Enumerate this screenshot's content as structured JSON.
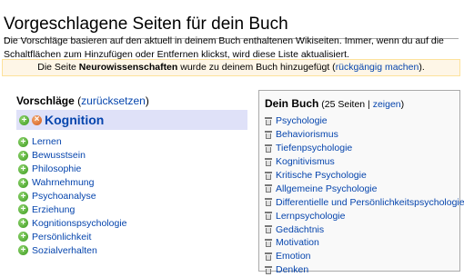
{
  "page": {
    "title": "Vorgeschlagene Seiten für dein Buch",
    "intro": "Die Vorschläge basieren auf den aktuell in deinem Buch enthaltenen Wikiseiten. Immer, wenn du auf die Schaltflächen zum Hinzufügen oder Entfernen klickst, wird diese Liste aktualisiert."
  },
  "notice": {
    "prefix": "Die Seite ",
    "page_name": "Neurowissenschaften",
    "middle": " wurde zu deinem Buch hinzugefügt (",
    "undo_link": "rückgängig machen",
    "suffix": ")."
  },
  "suggestions": {
    "heading": "Vorschläge",
    "reset_open": " (",
    "reset_link": "zurücksetzen",
    "reset_close": ")",
    "highlighted": "Kognition",
    "items": [
      "Lernen",
      "Bewusstsein",
      "Philosophie",
      "Wahrnehmung",
      "Psychoanalyse",
      "Erziehung",
      "Kognitionspsychologie",
      "Persönlichkeit",
      "Sozialverhalten"
    ]
  },
  "book": {
    "heading": "Dein Buch",
    "count_text": " (25 Seiten | ",
    "show_link": "zeigen",
    "count_close": ")",
    "items": [
      "Psychologie",
      "Behaviorismus",
      "Tiefenpsychologie",
      "Kognitivismus",
      "Kritische Psychologie",
      "Allgemeine Psychologie",
      "Differentielle und Persönlichkeitspsychologie",
      "Lernpsychologie",
      "Gedächtnis",
      "Motivation",
      "Emotion",
      "Denken"
    ]
  }
}
